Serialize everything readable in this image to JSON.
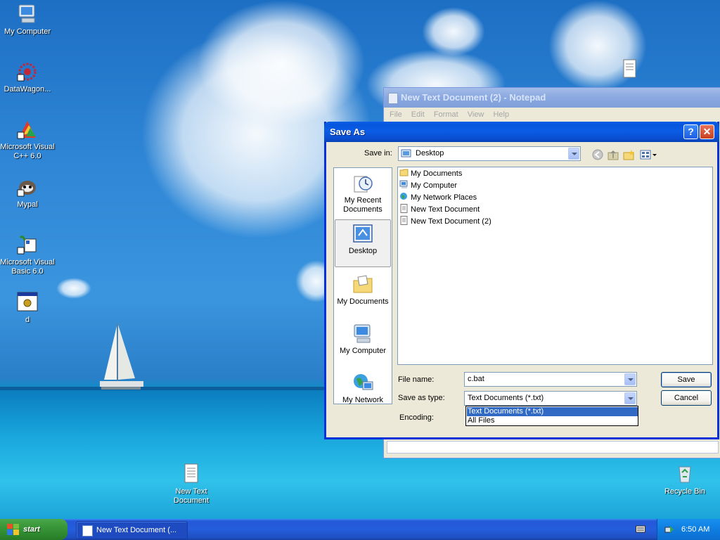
{
  "desktop": {
    "icons": [
      {
        "label": "My Computer",
        "icon": "computer-icon"
      },
      {
        "label": "DataWagon...",
        "icon": "datawagon-icon"
      },
      {
        "label": "Microsoft Visual C++ 6.0",
        "icon": "visual-cpp-icon"
      },
      {
        "label": "Mypal",
        "icon": "mypal-icon"
      },
      {
        "label": "Microsoft Visual Basic 6.0",
        "icon": "visual-basic-icon"
      },
      {
        "label": "d",
        "icon": "batch-file-icon"
      },
      {
        "label": "New Text Document",
        "icon": "text-document-icon"
      },
      {
        "label": "Recycle Bin",
        "icon": "recycle-bin-icon"
      }
    ]
  },
  "notepad": {
    "title": "New Text Document (2) - Notepad",
    "menu": [
      "File",
      "Edit",
      "Format",
      "View",
      "Help"
    ]
  },
  "dialog": {
    "title": "Save As",
    "help_label": "?",
    "close_label": "✕",
    "save_in_label": "Save in:",
    "save_in_value": "Desktop",
    "places": [
      "My Recent Documents",
      "Desktop",
      "My Documents",
      "My Computer",
      "My Network"
    ],
    "selected_place": "Desktop",
    "files": [
      "My Documents",
      "My Computer",
      "My Network Places",
      "New Text Document",
      "New Text Document (2)"
    ],
    "file_name_label": "File name:",
    "file_name_value": "c.bat",
    "save_type_label": "Save as type:",
    "save_type_value": "Text Documents (*.txt)",
    "save_type_options": [
      "Text Documents (*.txt)",
      "All Files"
    ],
    "selected_option": "Text Documents (*.txt)",
    "encoding_label": "Encoding:",
    "save_button": "Save",
    "cancel_button": "Cancel"
  },
  "taskbar": {
    "start_label": "start",
    "task_label": "New Text Document (...",
    "clock": "6:50 AM"
  },
  "colors": {
    "title_bar": "#0a5fe8",
    "selection": "#316ac5",
    "taskbar": "#245edc",
    "start_button": "#3c9a3c"
  }
}
